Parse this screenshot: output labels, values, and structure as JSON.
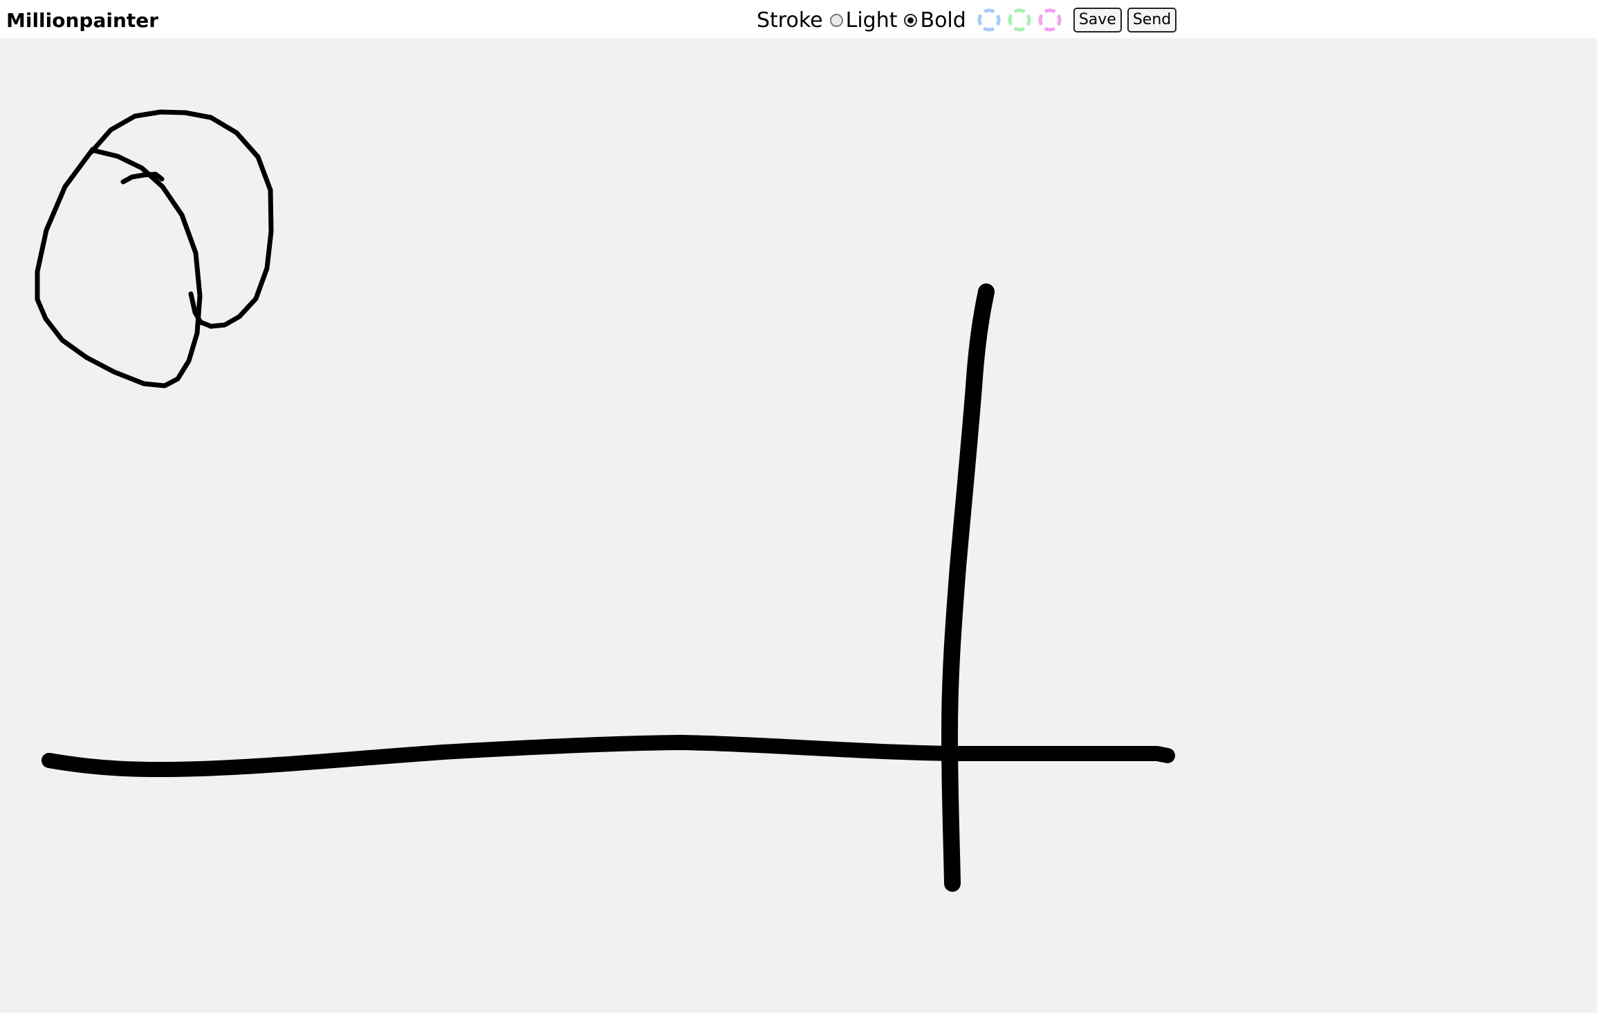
{
  "app": {
    "title": "Millionpainter"
  },
  "toolbar": {
    "stroke_label": "Stroke",
    "options": [
      {
        "label": "Light",
        "checked": false
      },
      {
        "label": "Bold",
        "checked": true
      }
    ],
    "swatches": [
      {
        "name": "blue",
        "color": "#a8cdf5"
      },
      {
        "name": "green",
        "color": "#a9efad"
      },
      {
        "name": "pink",
        "color": "#f0a3ee"
      }
    ],
    "save_label": "Save",
    "send_label": "Send"
  },
  "canvas": {
    "background": "#f1f1f1",
    "stroke_color": "#000000"
  }
}
